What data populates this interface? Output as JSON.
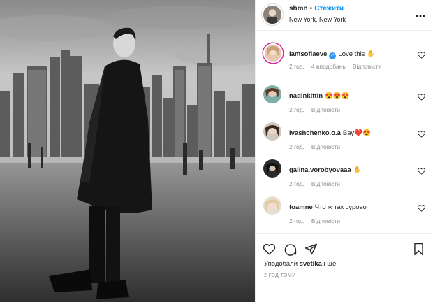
{
  "post": {
    "username": "shmn",
    "follow_label": "Стежити",
    "separator": "•",
    "location": "New York, New York",
    "more_icon": "more-options-icon"
  },
  "comments": [
    {
      "username": "iamsofiaeve",
      "verified": true,
      "text": "Love this ✋",
      "time": "2 год.",
      "likes": "4 вподобань",
      "reply": "Відповісти"
    },
    {
      "username": "nadinkittin",
      "verified": false,
      "text": "😍😍😍",
      "time": "2 год.",
      "reply": "Відповісти"
    },
    {
      "username": "ivashchenko.o.a",
      "verified": false,
      "text": "Вау❤️😍",
      "time": "2 год.",
      "reply": "Відповісти"
    },
    {
      "username": "galina.vorobyovaaa",
      "verified": false,
      "text": "✋",
      "time": "2 год.",
      "reply": "Відповісти"
    },
    {
      "username": "toamne",
      "verified": false,
      "text": "Что ж так сурово",
      "time": "2 год.",
      "reply": "Відповісти"
    }
  ],
  "actions": {
    "liked_prefix": "Уподобали",
    "liked_user": "svetika",
    "liked_suffix": "і ще",
    "timestamp": "2 ГОД ТОМУ"
  },
  "colors": {
    "link": "#0095f6",
    "muted": "#8e8e8e",
    "text": "#262626",
    "verified": "#3897f0"
  }
}
